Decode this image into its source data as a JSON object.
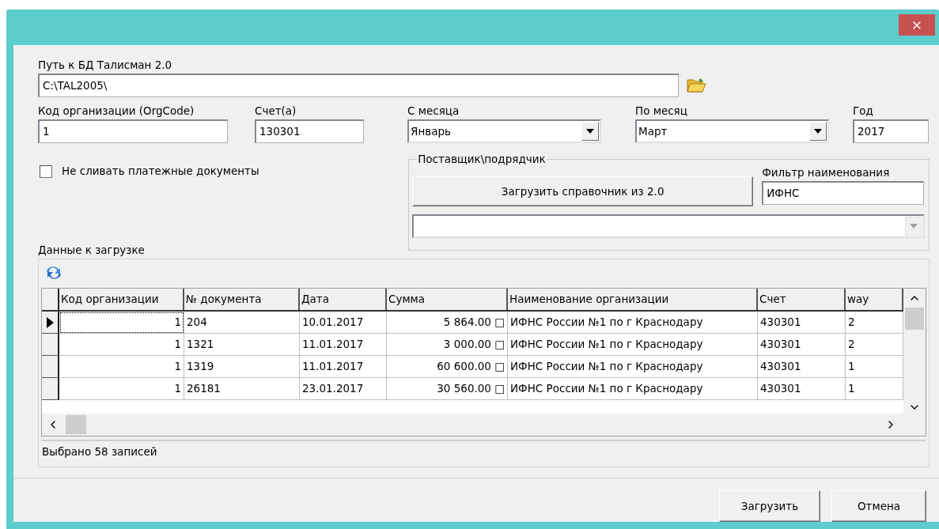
{
  "path": {
    "label": "Путь к БД Талисман 2.0",
    "value": "C:\\TAL2005\\"
  },
  "fields": [
    {
      "kind": "text",
      "label": "Код организации (OrgCode)",
      "value": "1"
    },
    {
      "kind": "text",
      "label": "Счет(а)",
      "value": "130301"
    },
    {
      "kind": "combo",
      "label": "С месяца",
      "value": "Январь"
    },
    {
      "kind": "combo",
      "label": "По месяц",
      "value": "Март"
    },
    {
      "kind": "text",
      "label": "Год",
      "value": "2017"
    }
  ],
  "merge_checkbox": {
    "label": "Не сливать платежные документы",
    "checked": false
  },
  "supplier_group": {
    "title": "Поставщик\\подрядчик",
    "load_button": "Загрузить справочник из 2.0",
    "filter": {
      "label": "Фильтр наименования",
      "value": "ИФНС"
    },
    "combo": {
      "disabled": true
    }
  },
  "data_section": {
    "label": "Данные к загрузке"
  },
  "table": {
    "columns": [
      "Код организации",
      "№ документа",
      "Дата",
      "Сумма",
      "Наименование организации",
      "Счет",
      "way"
    ],
    "rows": [
      {
        "current": true,
        "cells": [
          "1",
          "204",
          "10.01.2017",
          "5 864.00 □",
          "ИФНС России №1 по г Краснодару",
          "430301",
          "2"
        ]
      },
      {
        "current": false,
        "cells": [
          "1",
          "1321",
          "11.01.2017",
          "3 000.00 □",
          "ИФНС России №1 по г Краснодару",
          "430301",
          "2"
        ]
      },
      {
        "current": false,
        "cells": [
          "1",
          "1319",
          "11.01.2017",
          "60 600.00 □",
          "ИФНС России №1 по г Краснодару",
          "430301",
          "1"
        ]
      },
      {
        "current": false,
        "cells": [
          "1",
          "26181",
          "23.01.2017",
          "30 560.00 □",
          "ИФНС России №1 по г Краснодару",
          "430301",
          "1"
        ]
      }
    ]
  },
  "status_bar": "Выбрано 58 записей",
  "buttons": [
    "Загрузить",
    "Отмена"
  ]
}
